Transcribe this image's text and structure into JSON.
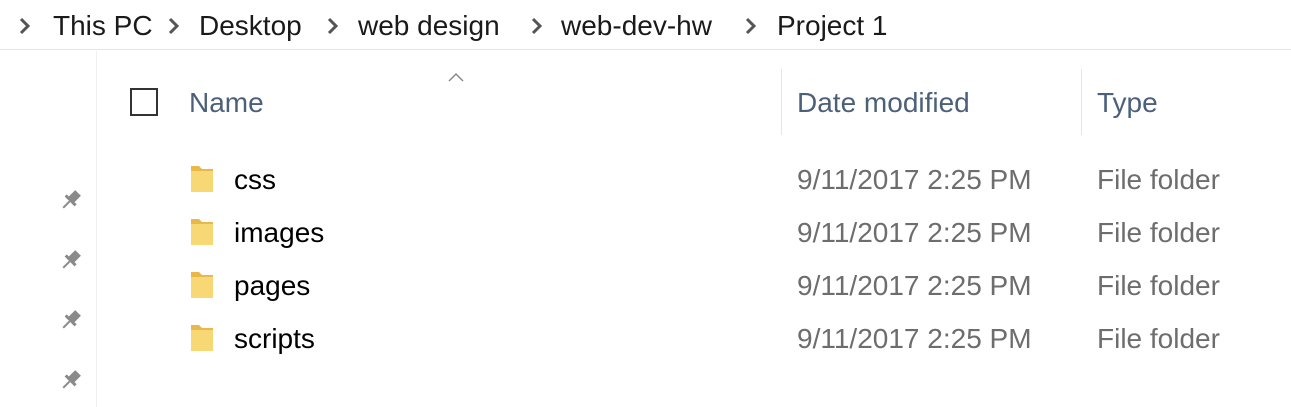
{
  "breadcrumb": {
    "items": [
      "This PC",
      "Desktop",
      "web design",
      "web-dev-hw",
      "Project 1"
    ]
  },
  "columns": {
    "name": "Name",
    "date_modified": "Date modified",
    "type": "Type"
  },
  "files": [
    {
      "name": "css",
      "date": "9/11/2017 2:25 PM",
      "type": "File folder"
    },
    {
      "name": "images",
      "date": "9/11/2017 2:25 PM",
      "type": "File folder"
    },
    {
      "name": "pages",
      "date": "9/11/2017 2:25 PM",
      "type": "File folder"
    },
    {
      "name": "scripts",
      "date": "9/11/2017 2:25 PM",
      "type": "File folder"
    }
  ],
  "colors": {
    "header_text": "#4c607a",
    "folder_yellow": "#f8d775",
    "pin_gray": "#8a8a8a"
  },
  "icons": {
    "separator": "chevron-right-icon",
    "folder": "folder-icon",
    "pin": "pin-icon",
    "sort": "sort-ascending-icon"
  }
}
